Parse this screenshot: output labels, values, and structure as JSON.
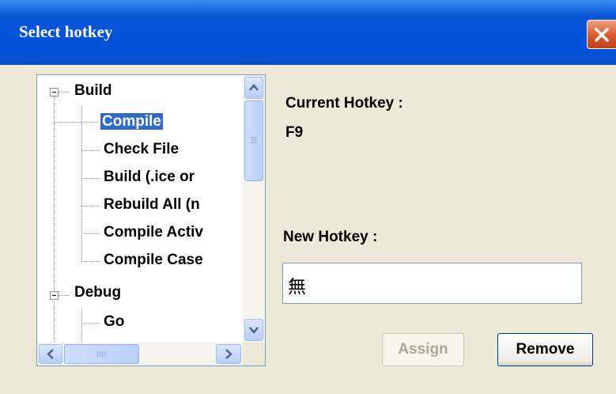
{
  "window": {
    "title": "Select hotkey"
  },
  "tree": {
    "nodes": [
      {
        "label": "Build",
        "level": 0,
        "expander": "minus"
      },
      {
        "label": "Compile",
        "level": 1,
        "selected": true
      },
      {
        "label": "Check File",
        "level": 1
      },
      {
        "label": "Build (.ice or",
        "level": 1
      },
      {
        "label": "Rebuild All (n",
        "level": 1
      },
      {
        "label": "Compile Activ",
        "level": 1
      },
      {
        "label": "Compile Case",
        "level": 1
      },
      {
        "label": "Debug",
        "level": 0,
        "expander": "minus"
      },
      {
        "label": "Go",
        "level": 1
      }
    ]
  },
  "current_hotkey": {
    "label": "Current Hotkey :",
    "value": "F9"
  },
  "new_hotkey": {
    "label": "New Hotkey :",
    "value": "無"
  },
  "buttons": {
    "assign": "Assign",
    "remove": "Remove"
  },
  "icons": {
    "close": "close-icon",
    "scroll_up": "chevron-up-icon",
    "scroll_down": "chevron-down-icon",
    "scroll_left": "chevron-left-icon",
    "scroll_right": "chevron-right-icon"
  },
  "colors": {
    "titlebar": "#0a55d6",
    "selection": "#316ac5",
    "close": "#d9582c"
  }
}
